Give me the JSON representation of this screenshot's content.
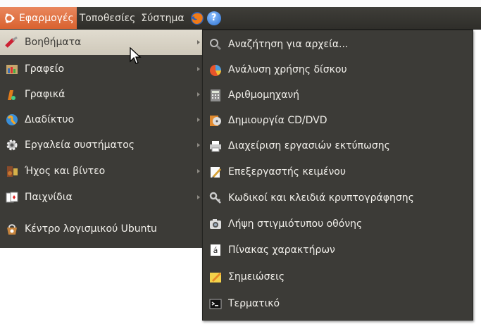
{
  "panel": {
    "menus": [
      {
        "label": "Εφαρμογές",
        "active": true
      },
      {
        "label": "Τοποθεσίες",
        "active": false
      },
      {
        "label": "Σύστημα",
        "active": false
      }
    ]
  },
  "applications_menu": {
    "items": [
      {
        "label": "Βοηθήματα",
        "icon": "accessories-icon",
        "submenu": true,
        "highlighted": true
      },
      {
        "label": "Γραφείο",
        "icon": "office-icon",
        "submenu": true
      },
      {
        "label": "Γραφικά",
        "icon": "graphics-icon",
        "submenu": true
      },
      {
        "label": "Διαδίκτυο",
        "icon": "internet-icon",
        "submenu": true
      },
      {
        "label": "Εργαλεία συστήματος",
        "icon": "system-tools-icon",
        "submenu": true
      },
      {
        "label": "Ήχος και βίντεο",
        "icon": "sound-video-icon",
        "submenu": true
      },
      {
        "label": "Παιχνίδια",
        "icon": "games-icon",
        "submenu": true
      },
      {
        "label": "Κέντρο λογισμικού Ubuntu",
        "icon": "software-center-icon",
        "submenu": false
      }
    ]
  },
  "accessories_submenu": {
    "items": [
      {
        "label": "Αναζήτηση για αρχεία...",
        "icon": "search-icon"
      },
      {
        "label": "Ανάλυση χρήσης δίσκου",
        "icon": "disk-usage-icon"
      },
      {
        "label": "Αριθμομηχανή",
        "icon": "calculator-icon"
      },
      {
        "label": "Δημιουργία CD/DVD",
        "icon": "cd-dvd-icon"
      },
      {
        "label": "Διαχείριση εργασιών εκτύπωσης",
        "icon": "printer-icon"
      },
      {
        "label": "Επεξεργαστής κειμένου",
        "icon": "text-editor-icon"
      },
      {
        "label": "Κωδικοί και κλειδιά κρυπτογράφησης",
        "icon": "keys-icon"
      },
      {
        "label": "Λήψη στιγμιότυπου οθόνης",
        "icon": "screenshot-icon"
      },
      {
        "label": "Πίνακας χαρακτήρων",
        "icon": "character-map-icon",
        "glyph": "á"
      },
      {
        "label": "Σημειώσεις",
        "icon": "notes-icon"
      },
      {
        "label": "Τερματικό",
        "icon": "terminal-icon"
      }
    ]
  },
  "colors": {
    "menu_bg": "#3c3b37",
    "panel_active": "#e07a4a",
    "highlight": "#d8d2c4"
  }
}
